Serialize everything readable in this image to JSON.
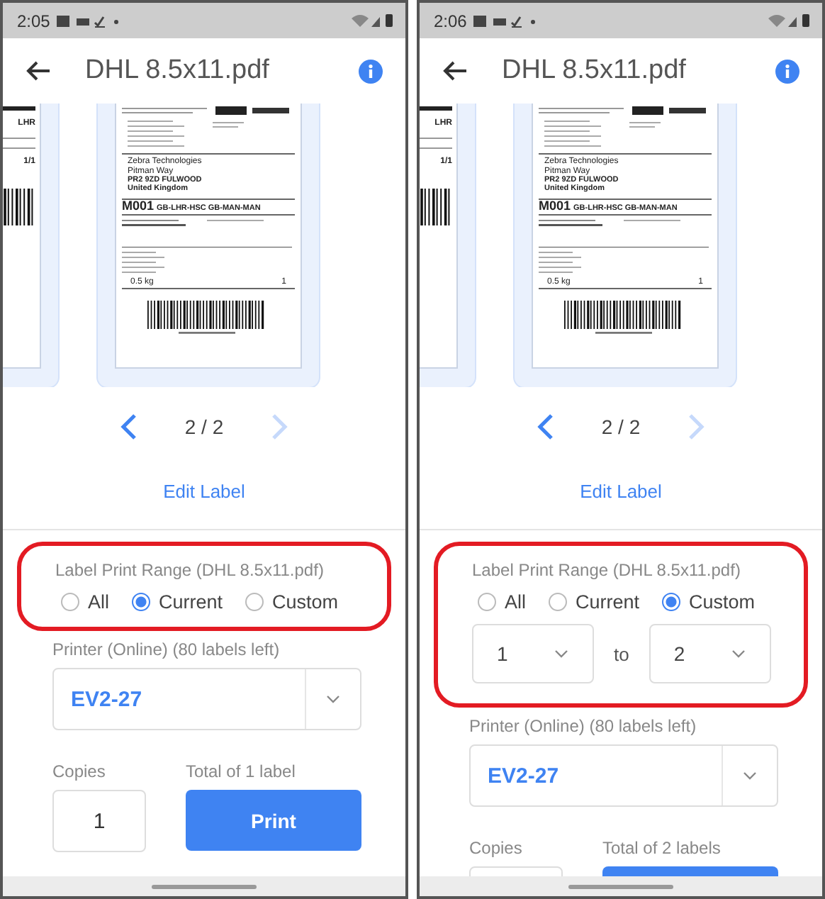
{
  "phones": [
    {
      "status_time": "2:05",
      "title": "DHL 8.5x11.pdf",
      "preview": {
        "side_texts": [
          "LHR",
          "1/1"
        ],
        "label_texts": {
          "recipient": [
            "Zebra Technologies",
            "Pitman Way"
          ],
          "city": [
            "PR2 9ZD FULWOOD",
            "United Kingdom"
          ],
          "route_code": "M001",
          "route": "GB-LHR-HSC  GB-MAN-MAN",
          "weight": "0.5 kg",
          "pieces": "1"
        }
      },
      "pager": {
        "text": "2 / 2",
        "prev_enabled": true,
        "next_enabled": false
      },
      "edit_label": "Edit Label",
      "range": {
        "highlighted": true,
        "label": "Label Print Range (DHL 8.5x11.pdf)",
        "options": [
          {
            "label": "All",
            "selected": false
          },
          {
            "label": "Current",
            "selected": true
          },
          {
            "label": "Custom",
            "selected": false
          }
        ]
      },
      "printer": {
        "label": "Printer (Online) (80 labels left)",
        "value": "EV2-27"
      },
      "copies": {
        "label": "Copies",
        "value": "1"
      },
      "total": "Total of 1 label",
      "print_button": {
        "label": "Print"
      }
    },
    {
      "status_time": "2:06",
      "title": "DHL 8.5x11.pdf",
      "preview": {
        "side_texts": [
          "LHR",
          "1/1"
        ],
        "label_texts": {
          "recipient": [
            "Zebra Technologies",
            "Pitman Way"
          ],
          "city": [
            "PR2 9ZD FULWOOD",
            "United Kingdom"
          ],
          "route_code": "M001",
          "route": "GB-LHR-HSC  GB-MAN-MAN",
          "weight": "0.5 kg",
          "pieces": "1"
        }
      },
      "pager": {
        "text": "2 / 2",
        "prev_enabled": true,
        "next_enabled": false
      },
      "edit_label": "Edit Label",
      "range": {
        "highlighted": true,
        "label": "Label Print Range (DHL 8.5x11.pdf)",
        "options": [
          {
            "label": "All",
            "selected": false
          },
          {
            "label": "Current",
            "selected": false
          },
          {
            "label": "Custom",
            "selected": true
          }
        ],
        "custom_range": {
          "from": "1",
          "separator": "to",
          "to": "2"
        }
      },
      "printer": {
        "label": "Printer (Online) (80 labels left)",
        "value": "EV2-27"
      },
      "copies": {
        "label": "Copies"
      },
      "total": "Total of 2 labels"
    }
  ]
}
